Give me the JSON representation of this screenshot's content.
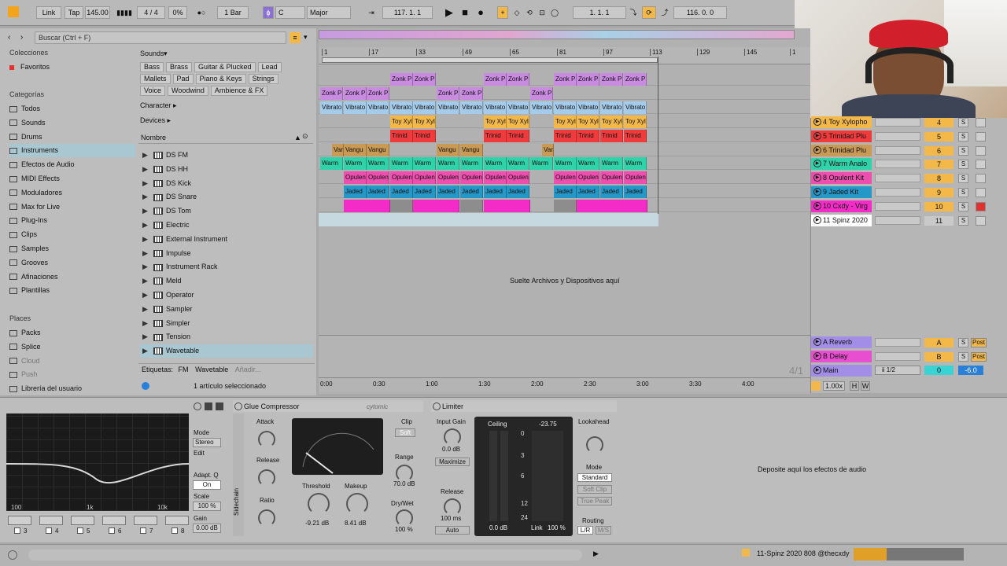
{
  "transport": {
    "link": "Link",
    "tap": "Tap",
    "tempo": "145.00",
    "signature": "4 / 4",
    "cpu": "0%",
    "quantize": "1 Bar",
    "key": "C",
    "scale": "Major",
    "position": "117.  1.  1",
    "loop_start": "1.  1.  1",
    "loop_length": "116.  0.  0"
  },
  "browser": {
    "search_placeholder": "Buscar (Ctrl + F)",
    "collections_title": "Colecciones",
    "favorites": "Favoritos",
    "categories_title": "Categorías",
    "categories": [
      "Todos",
      "Sounds",
      "Drums",
      "Instruments",
      "Efectos de Audio",
      "MIDI Effects",
      "Moduladores",
      "Max for Live",
      "Plug-Ins",
      "Clips",
      "Samples",
      "Grooves",
      "Afinaciones",
      "Plantillas"
    ],
    "places_title": "Places",
    "places": [
      "Packs",
      "Splice",
      "Cloud",
      "Push",
      "Librería del usuario"
    ],
    "sounds_label": "Sounds",
    "sound_tags_1": [
      "Bass",
      "Brass",
      "Guitar & Plucked",
      "Lead"
    ],
    "sound_tags_2": [
      "Mallets",
      "Pad",
      "Piano & Keys",
      "Strings"
    ],
    "sound_tags_3": [
      "Voice",
      "Woodwind",
      "Ambience & FX"
    ],
    "character_label": "Character",
    "devices_label": "Devices",
    "column_name": "Nombre",
    "tree": [
      "DS FM",
      "DS HH",
      "DS Kick",
      "DS Snare",
      "DS Tom",
      "Electric",
      "External Instrument",
      "Impulse",
      "Instrument Rack",
      "Meld",
      "Operator",
      "Sampler",
      "Simpler",
      "Tension",
      "Wavetable"
    ],
    "tags_label": "Etiquetas:",
    "tag_fm": "FM",
    "tag_wavetable": "Wavetable",
    "tag_add": "Añadir...",
    "selected_count": "1 artículo seleccionado"
  },
  "arrangement": {
    "ruler": [
      "1",
      "17",
      "33",
      "49",
      "65",
      "81",
      "97",
      "113",
      "129",
      "145",
      "1"
    ],
    "time_ruler": [
      "0:00",
      "0:30",
      "1:00",
      "1:30",
      "2:00",
      "2:30",
      "3:00",
      "3:30",
      "4:00"
    ],
    "drop_text": "Suelte Archivos y Dispositivos aquí",
    "signature_hint": "4/1",
    "clip_labels": {
      "zonk": "Zonk P",
      "vibrato": "Vibrato",
      "toy": "Toy Xyl",
      "trinidad": "Trinid",
      "vangu": "Vangu",
      "var": "Var",
      "warm": "Warm",
      "opulent": "Opulen",
      "jaded": "Jaded"
    }
  },
  "mixer": {
    "tracks": [
      {
        "name": "4 Toy Xylopho",
        "num": "4",
        "color": "#f2b84a"
      },
      {
        "name": "5 Trinidad Plu",
        "num": "5",
        "color": "#ef3b3b"
      },
      {
        "name": "6 Trinidad Plu",
        "num": "6",
        "color": "#c89a55"
      },
      {
        "name": "7 Warm Analo",
        "num": "7",
        "color": "#2ed3a9"
      },
      {
        "name": "8 Opulent Kit",
        "num": "8",
        "color": "#ec4fae"
      },
      {
        "name": "9 Jaded Kit",
        "num": "9",
        "color": "#2598c8"
      },
      {
        "name": "10 Cxdy - Virg",
        "num": "10",
        "color": "#f32cc7"
      },
      {
        "name": "11 Spinz 2020",
        "num": "11",
        "color": "#ffffff"
      }
    ],
    "returns": [
      {
        "name": "A Reverb",
        "send": "A",
        "color": "#a28ee6"
      },
      {
        "name": "B Delay",
        "send": "B",
        "color": "#e84fd0"
      }
    ],
    "main_name": "Main",
    "main_out": "ii 1/2",
    "main_vol": "0",
    "main_db": "-6.0",
    "solo": "S",
    "post": "Post",
    "zoom": "1.00x",
    "h": "H",
    "w": "W"
  },
  "devices": {
    "eq_mode_label": "Mode",
    "eq_mode": "Stereo",
    "eq_edit": "Edit",
    "eq_adapt": "Adapt. Q",
    "eq_adapt_val": "On",
    "eq_scale": "Scale",
    "eq_scale_val": "100 %",
    "eq_gain": "Gain",
    "eq_gain_val": "0.00 dB",
    "eq_freqs": [
      "100",
      "1k",
      "10k"
    ],
    "eq_bands": [
      "3",
      "4",
      "5",
      "6",
      "7",
      "8"
    ],
    "glue_title": "Glue Compressor",
    "glue_brand": "cytomic",
    "glue_attack": "Attack",
    "glue_release": "Release",
    "glue_ratio": "Ratio",
    "glue_threshold": "Threshold",
    "glue_threshold_val": "-9.21 dB",
    "glue_makeup": "Makeup",
    "glue_makeup_val": "8.41 dB",
    "glue_clip": "Clip",
    "glue_soft": "Soft",
    "glue_range": "Range",
    "glue_range_val": "70.0 dB",
    "glue_drywet": "Dry/Wet",
    "glue_drywet_val": "100 %",
    "glue_sidechain": "Sidechain",
    "limiter_title": "Limiter",
    "lim_input": "Input Gain",
    "lim_input_val": "0.0 dB",
    "lim_maximize": "Maximize",
    "lim_release": "Release",
    "lim_release_val": "100 ms",
    "lim_auto": "Auto",
    "lim_ceiling": "Ceiling",
    "lim_ceiling_val": "-23.75",
    "lim_scale": [
      "0",
      "3",
      "6",
      "12",
      "24"
    ],
    "lim_ceiling_db": "0.0 dB",
    "lim_link": "Link",
    "lim_link_val": "100 %",
    "lim_lookahead": "Lookahead",
    "lim_mode": "Mode",
    "lim_standard": "Standard",
    "lim_softclip": "Soft Clip",
    "lim_truepeak": "True Peak",
    "lim_routing": "Routing",
    "lim_lr": "L/R",
    "lim_ms": "M/S",
    "drop_fx": "Deposite aquí los efectos de audio"
  },
  "status": {
    "track": "11-Spinz 2020 808 @thecxdy"
  }
}
